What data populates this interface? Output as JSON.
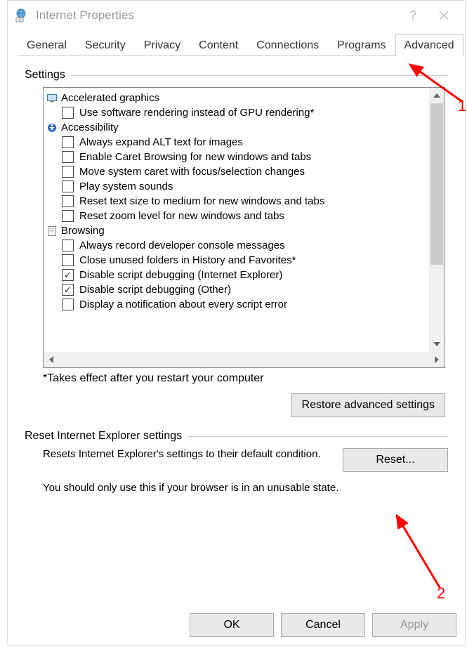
{
  "window": {
    "title": "Internet Properties",
    "help_symbol": "?",
    "close_symbol": "×"
  },
  "tabs": [
    {
      "id": "general",
      "label": "General"
    },
    {
      "id": "security",
      "label": "Security"
    },
    {
      "id": "privacy",
      "label": "Privacy"
    },
    {
      "id": "content",
      "label": "Content"
    },
    {
      "id": "connections",
      "label": "Connections"
    },
    {
      "id": "programs",
      "label": "Programs"
    },
    {
      "id": "advanced",
      "label": "Advanced",
      "active": true
    }
  ],
  "settings": {
    "group_label": "Settings",
    "categories": [
      {
        "icon": "monitor-icon",
        "label": "Accelerated graphics",
        "items": [
          {
            "checked": false,
            "label": "Use software rendering instead of GPU rendering*"
          }
        ]
      },
      {
        "icon": "accessibility-icon",
        "label": "Accessibility",
        "items": [
          {
            "checked": false,
            "label": "Always expand ALT text for images"
          },
          {
            "checked": false,
            "label": "Enable Caret Browsing for new windows and tabs"
          },
          {
            "checked": false,
            "label": "Move system caret with focus/selection changes"
          },
          {
            "checked": false,
            "label": "Play system sounds"
          },
          {
            "checked": false,
            "label": "Reset text size to medium for new windows and tabs"
          },
          {
            "checked": false,
            "label": "Reset zoom level for new windows and tabs"
          }
        ]
      },
      {
        "icon": "page-icon",
        "label": "Browsing",
        "items": [
          {
            "checked": false,
            "label": "Always record developer console messages"
          },
          {
            "checked": false,
            "label": "Close unused folders in History and Favorites*"
          },
          {
            "checked": true,
            "label": "Disable script debugging (Internet Explorer)"
          },
          {
            "checked": true,
            "label": "Disable script debugging (Other)"
          },
          {
            "checked": false,
            "label": "Display a notification about every script error"
          }
        ]
      }
    ],
    "note": "*Takes effect after you restart your computer",
    "restore_button": "Restore advanced settings"
  },
  "reset": {
    "group_label": "Reset Internet Explorer settings",
    "description": "Resets Internet Explorer's settings to their default condition.",
    "button": "Reset...",
    "warning": "You should only use this if your browser is in an unusable state."
  },
  "buttons": {
    "ok": "OK",
    "cancel": "Cancel",
    "apply": "Apply"
  },
  "annotations": {
    "label1": "1",
    "label2": "2"
  }
}
